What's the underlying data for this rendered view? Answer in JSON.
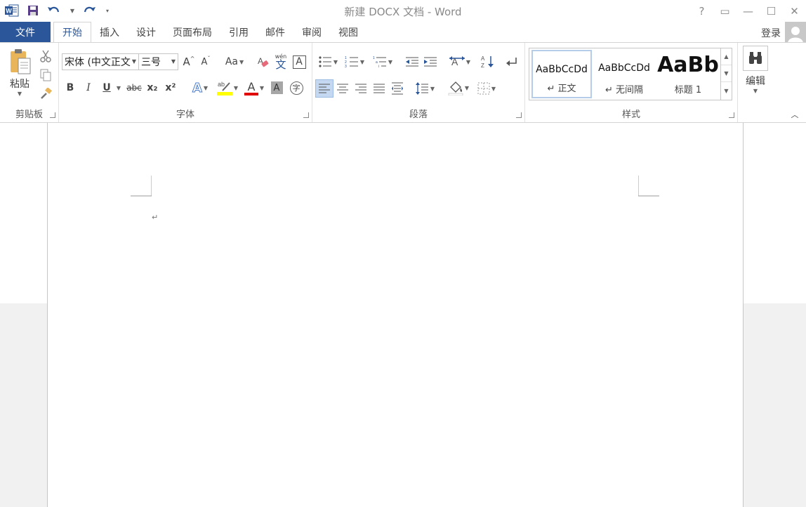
{
  "app": {
    "title": "新建 DOCX 文档 - Word"
  },
  "window_controls": {
    "help": "?",
    "ribbon_options": "▭",
    "minimize": "—",
    "maximize": "☐",
    "close": "✕"
  },
  "qat": {
    "icons": [
      "word-logo-icon",
      "save-icon",
      "undo-icon",
      "redo-icon",
      "customize-qat-icon"
    ]
  },
  "tabs": {
    "file": "文件",
    "items": [
      "开始",
      "插入",
      "设计",
      "页面布局",
      "引用",
      "邮件",
      "审阅",
      "视图"
    ],
    "active": "开始",
    "login": "登录"
  },
  "ribbon": {
    "clipboard": {
      "label": "剪贴板",
      "paste": "粘贴"
    },
    "font": {
      "label": "字体",
      "font_name": "宋体 (中文正文",
      "font_size": "三号",
      "grow": "A",
      "shrink": "A",
      "case": "Aa",
      "bold": "B",
      "italic": "I",
      "underline": "U",
      "strike": "abc",
      "subscript": "x₂",
      "superscript": "x²",
      "phonetic_top": "wén",
      "phonetic_bottom": "文",
      "char_border": "A",
      "text_effect": "A",
      "font_color": "A",
      "char_shading": "A",
      "enclose": "字"
    },
    "paragraph": {
      "label": "段落"
    },
    "styles": {
      "label": "样式",
      "items": [
        {
          "sample": "AaBbCcDd",
          "name": "↵ 正文"
        },
        {
          "sample": "AaBbCcDd",
          "name": "↵ 无间隔"
        },
        {
          "sample": "AaBb",
          "name": "标题 1"
        }
      ]
    },
    "editing": {
      "label": "编辑"
    },
    "colors": {
      "highlight": "#ffff00",
      "font_color": "#e00000",
      "accent": "#2b579a"
    }
  },
  "document": {
    "paragraph_mark": "↵"
  }
}
